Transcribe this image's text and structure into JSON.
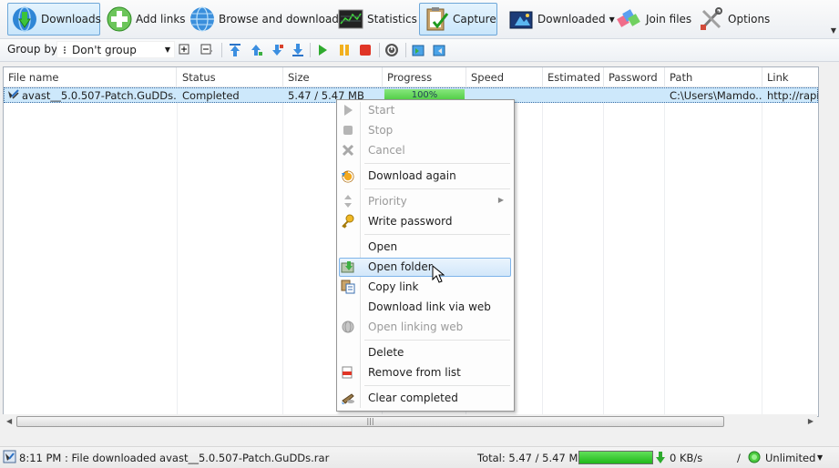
{
  "toolbar": {
    "downloads": "Downloads",
    "add_links": "Add links",
    "browse": "Browse and download",
    "statistics": "Statistics",
    "capture": "Capture",
    "downloaded": "Downloaded",
    "join_files": "Join files",
    "options": "Options"
  },
  "groupbar": {
    "label": "Group by",
    "group_value": "Don't group"
  },
  "columns": [
    "File name",
    "Status",
    "Size",
    "Progress",
    "Speed",
    "Estimated",
    "Password",
    "Path",
    "Link"
  ],
  "rows": [
    {
      "file_name": "avast__5.0.507-Patch.GuDDs.rar",
      "status": "Completed",
      "size": "5.47 / 5.47 MB",
      "progress": "100%",
      "speed": "",
      "estimated": "",
      "password": "",
      "path": "C:\\Users\\Mamdo...",
      "link": "http://rapid"
    }
  ],
  "context_menu": {
    "items": [
      {
        "label": "Start",
        "enabled": false,
        "icon": "play-icon"
      },
      {
        "label": "Stop",
        "enabled": false,
        "icon": "stop-icon"
      },
      {
        "label": "Cancel",
        "enabled": false,
        "icon": "cancel-icon"
      },
      {
        "label": "Download again",
        "enabled": true,
        "icon": "download-again-icon"
      },
      {
        "label": "Priority",
        "enabled": false,
        "icon": "priority-icon",
        "submenu": true
      },
      {
        "label": "Write password",
        "enabled": true,
        "icon": "key-icon"
      },
      {
        "label": "Open",
        "enabled": true
      },
      {
        "label": "Open folder",
        "enabled": true,
        "icon": "open-folder-icon",
        "highlighted": true
      },
      {
        "label": "Copy link",
        "enabled": true,
        "icon": "copy-icon"
      },
      {
        "label": "Download link via web",
        "enabled": true
      },
      {
        "label": "Open linking web",
        "enabled": false,
        "icon": "globe-icon"
      },
      {
        "label": "Delete",
        "enabled": true
      },
      {
        "label": "Remove from list",
        "enabled": true,
        "icon": "remove-icon"
      },
      {
        "label": "Clear completed",
        "enabled": true,
        "icon": "broom-icon"
      }
    ]
  },
  "statusbar": {
    "message": "8:11 PM : File downloaded avast__5.0.507-Patch.GuDDs.rar",
    "total": "Total: 5.47 / 5.47 MB",
    "total_progress": 1.0,
    "speed": "0 KB/s",
    "divider": "/",
    "limit": "Unlimited"
  },
  "colors": {
    "selection": "#cde8fb",
    "progress_green": "#4ccb40",
    "hover_border": "#7eb4ea"
  }
}
